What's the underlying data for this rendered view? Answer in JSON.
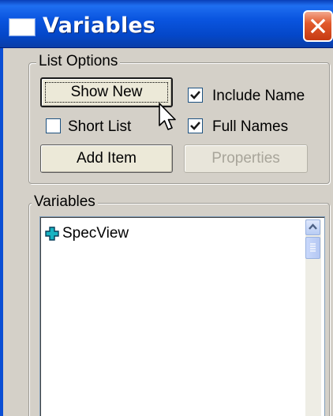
{
  "window": {
    "title": "Variables"
  },
  "list_options": {
    "legend": "List Options",
    "show_new_label": "Show New",
    "add_item_label": "Add Item",
    "properties_label": "Properties",
    "short_list": {
      "label": "Short List",
      "checked": false
    },
    "include_name": {
      "label": "Include Name",
      "checked": true
    },
    "full_names": {
      "label": "Full Names",
      "checked": true
    }
  },
  "variables": {
    "legend": "Variables",
    "items": [
      {
        "label": "SpecView",
        "icon": "plus-icon"
      }
    ]
  },
  "colors": {
    "titlebar": "#0a55e0",
    "close": "#e25a2c",
    "face": "#d4d0c8",
    "plus": "#17b3c2"
  }
}
